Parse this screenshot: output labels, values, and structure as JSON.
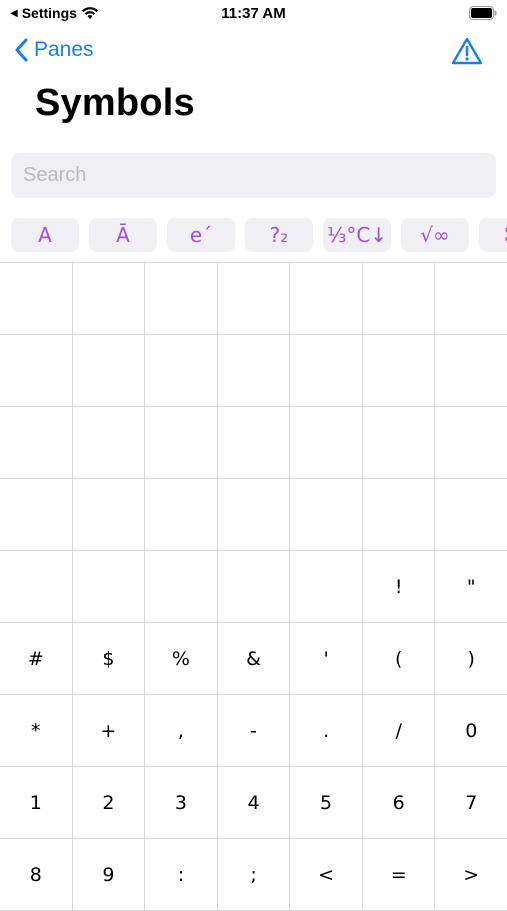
{
  "status_bar": {
    "back_app": "Settings",
    "time": "11:37 AM"
  },
  "nav": {
    "back_label": "Panes"
  },
  "page_title": "Symbols",
  "search": {
    "placeholder": "Search",
    "value": ""
  },
  "tabs": [
    {
      "label": "A"
    },
    {
      "label": "Ā"
    },
    {
      "label": "e´"
    },
    {
      "label": "?₂"
    },
    {
      "label": "⅓°C↓"
    },
    {
      "label": "√∞"
    },
    {
      "label": "⌘"
    }
  ],
  "grid": [
    [
      "",
      "",
      "",
      "",
      "",
      "",
      ""
    ],
    [
      "",
      "",
      "",
      "",
      "",
      "",
      ""
    ],
    [
      "",
      "",
      "",
      "",
      "",
      "",
      ""
    ],
    [
      "",
      "",
      "",
      "",
      "",
      "",
      ""
    ],
    [
      "",
      "",
      "",
      "",
      "",
      "!",
      "\""
    ],
    [
      "#",
      "$",
      "%",
      "&",
      "'",
      "(",
      ")"
    ],
    [
      "*",
      "+",
      ",",
      "-",
      ".",
      "/",
      "0"
    ],
    [
      "1",
      "2",
      "3",
      "4",
      "5",
      "6",
      "7"
    ],
    [
      "8",
      "9",
      ":",
      ";",
      "<",
      "=",
      ">"
    ]
  ],
  "colors": {
    "accent": "#1a7cf5",
    "tab_text": "#a34fdc",
    "tab_bg": "#efeff4",
    "grid_line": "#d9d9d9"
  }
}
